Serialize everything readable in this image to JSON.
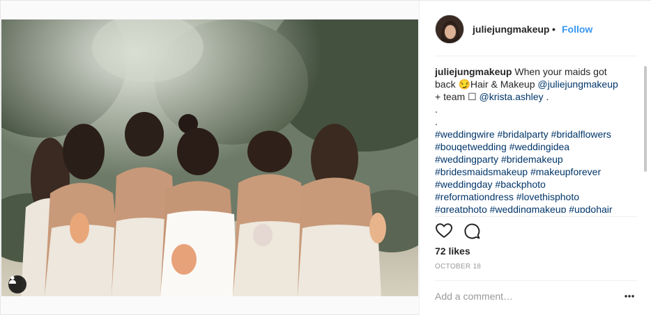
{
  "post": {
    "username": "juliejungmakeup",
    "dot": "•",
    "follow_label": "Follow",
    "caption": {
      "user": "juliejungmakeup",
      "line1_text": "When your maids got",
      "line2_prefix": "back ",
      "line2_emoji": "😏",
      "line2_text": "Hair & Makeup ",
      "line2_mention": "@juliejungmakeup",
      "line3_text": "+ team ☐ ",
      "line3_mention": "@krista.ashley",
      "line3_suffix": " .",
      "dot_line_1": ".",
      "dot_line_2": ".",
      "hashtag_lines": [
        [
          "#weddingwire",
          "#bridalparty",
          "#bridalflowers"
        ],
        [
          "#bouqetwedding",
          "#weddingidea"
        ],
        [
          "#weddingparty",
          "#bridemakeup"
        ],
        [
          "#bridesmaidsmakeup",
          "#makeupforever"
        ],
        [
          "#weddingday",
          "#backphoto"
        ],
        [
          "#reformationdress",
          "#lovethisphoto"
        ],
        [
          "#greatphoto",
          "#weddingmakeup",
          "#updohair"
        ]
      ]
    },
    "likes_label": "72 likes",
    "date_label": "OCTOBER 18",
    "comment_placeholder": "Add a comment…",
    "icons": {
      "like": "heart-icon",
      "comment": "comment-icon",
      "more": "more-options-icon",
      "tag": "user-tag-icon"
    },
    "colors": {
      "follow": "#3897f0",
      "link": "#003569",
      "muted": "#999999"
    }
  }
}
